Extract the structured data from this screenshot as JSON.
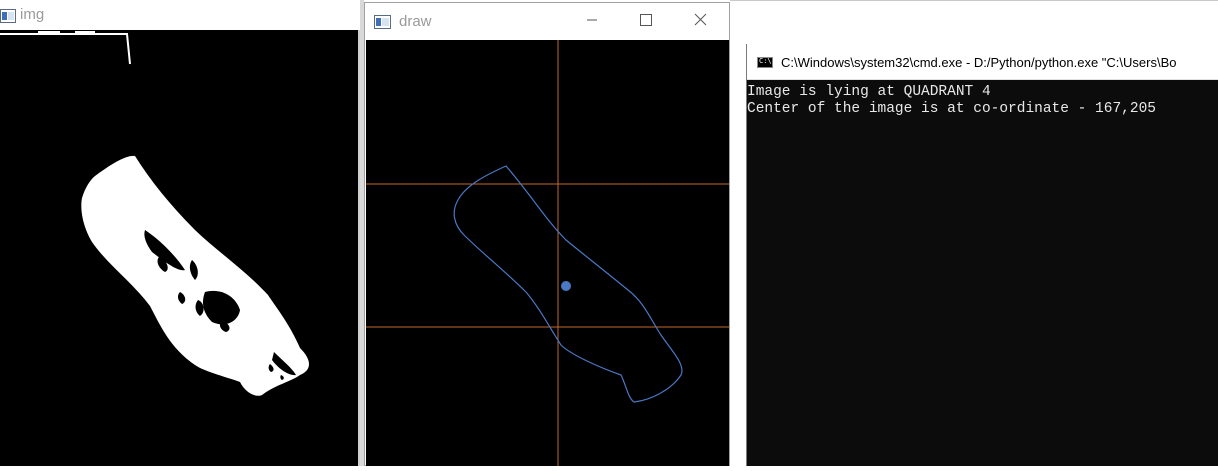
{
  "windows": {
    "img": {
      "title": "img",
      "icon": "window-app-icon"
    },
    "draw": {
      "title": "draw",
      "icon": "window-app-icon",
      "controls": {
        "minimize": "minimize-icon",
        "maximize": "maximize-icon",
        "close": "close-icon"
      },
      "colors": {
        "crosshair": "#c0692a",
        "contour": "#4a78c4",
        "center_dot": "#4a78c4"
      }
    },
    "cmd": {
      "title": "C:\\Windows\\system32\\cmd.exe - D:/Python/python.exe  \"C:\\Users\\Bo",
      "icon": "console-icon",
      "lines": [
        "Image is lying at QUADRANT 4",
        "Center of the image is at co-ordinate - 167,205"
      ]
    }
  }
}
